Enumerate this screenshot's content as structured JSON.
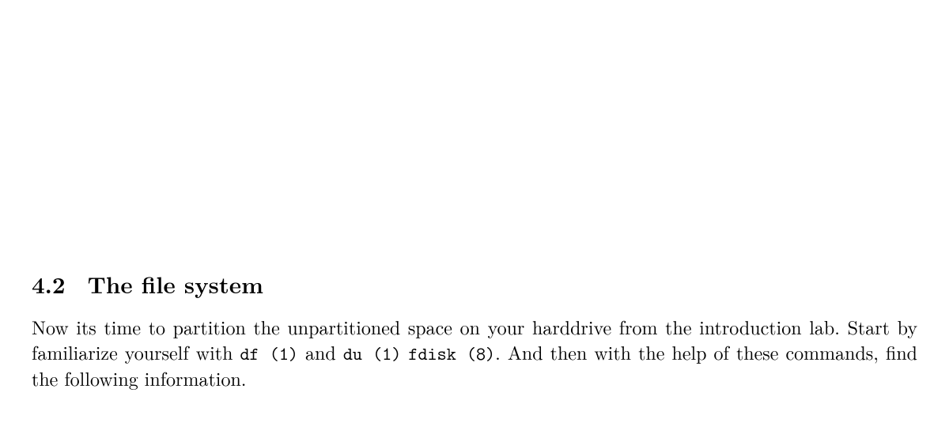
{
  "section": {
    "number": "4.2",
    "title": "The file system"
  },
  "paragraph": {
    "part1": "Now its time to partition the unpartitioned space on your harddrive from the introduction lab. Start by familiarize yourself with ",
    "cmd1": "df (1)",
    "part2": " and ",
    "cmd2": "du (1)",
    "part3": " ",
    "cmd3": "fdisk (8)",
    "part4": ". And then with the help of these commands, find the following information."
  }
}
